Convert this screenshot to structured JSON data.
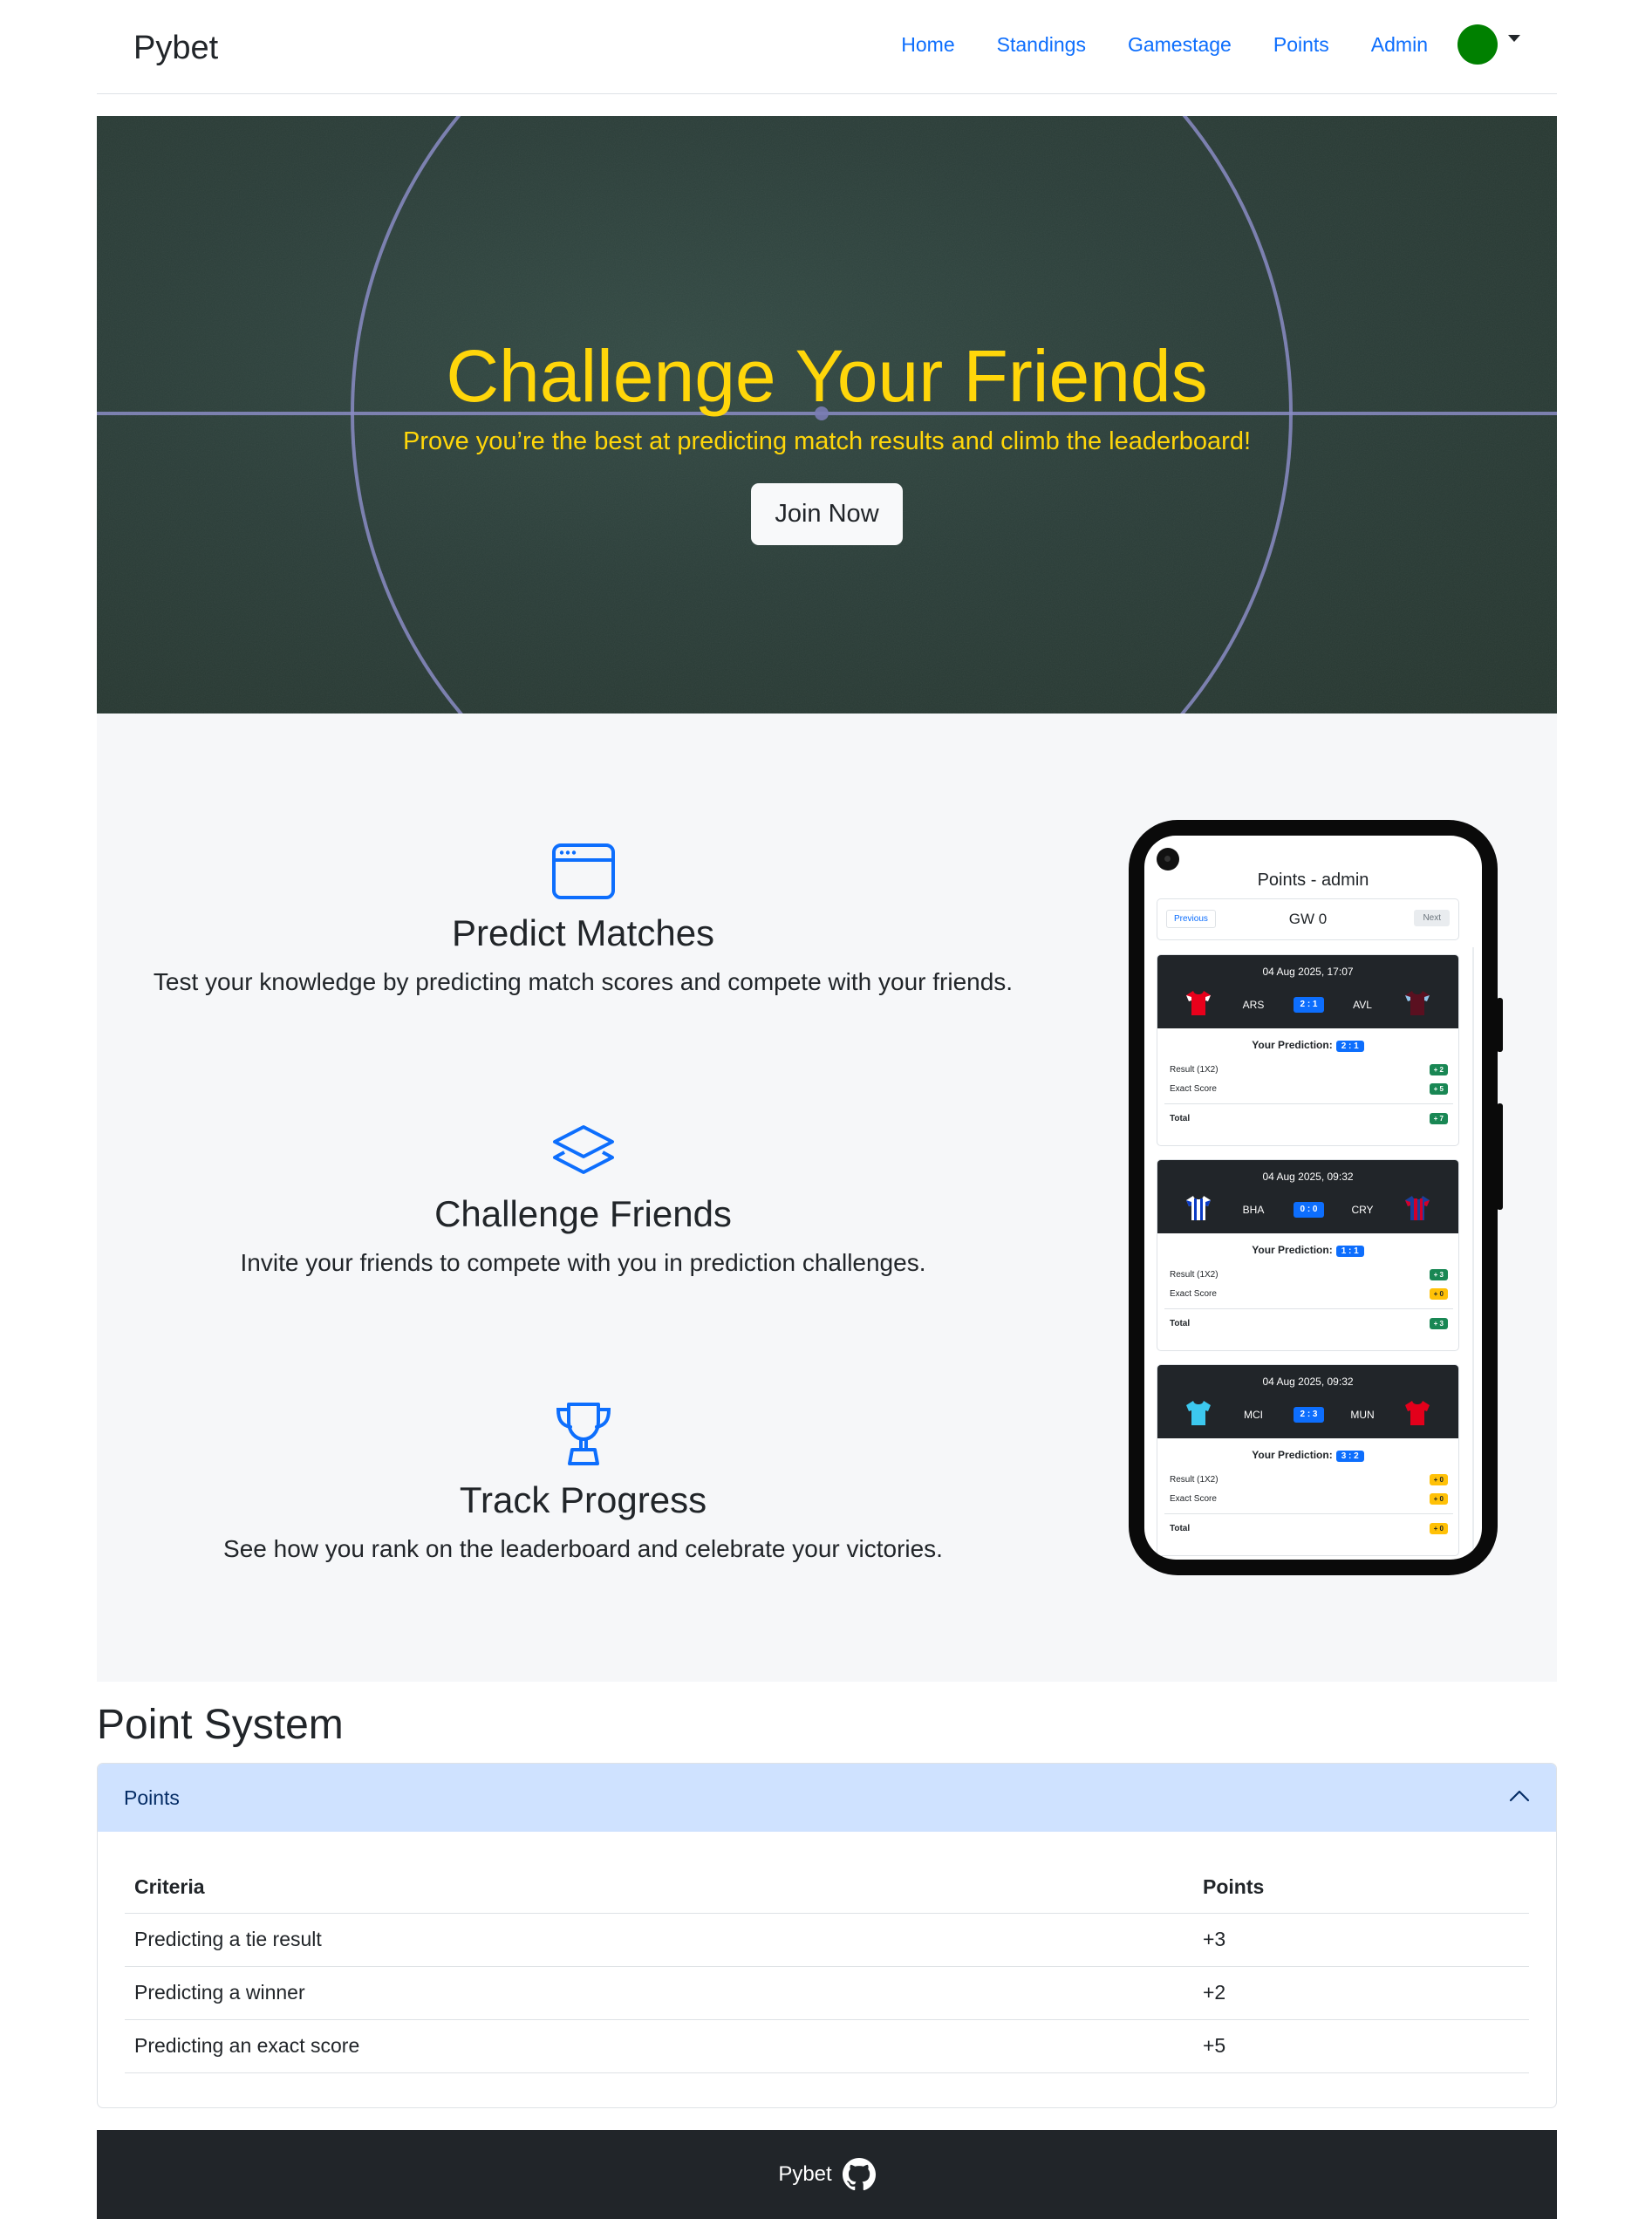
{
  "navbar": {
    "brand": "Pybet",
    "links": [
      "Home",
      "Standings",
      "Gamestage",
      "Points",
      "Admin"
    ],
    "avatar_color": "#008000"
  },
  "hero": {
    "title": "Challenge Your Friends",
    "subtitle": "Prove you’re the best at predicting match results and climb the leaderboard!",
    "button_label": "Join Now",
    "title_color": "#ffd60a"
  },
  "features": [
    {
      "icon": "browser-window-icon",
      "title": "Predict Matches",
      "description": "Test your knowledge by predicting match scores and compete with your friends."
    },
    {
      "icon": "layers-icon",
      "title": "Challenge Friends",
      "description": "Invite your friends to compete with you in prediction challenges."
    },
    {
      "icon": "trophy-icon",
      "title": "Track Progress",
      "description": "See how you rank on the leaderboard and celebrate your victories."
    }
  ],
  "phone": {
    "screen_title": "Points - admin",
    "prev_label": "Previous",
    "next_label": "Next",
    "gameweek": "GW 0",
    "your_prediction_label": "Your Prediction:",
    "result_label": "Result (1X2)",
    "exact_label": "Exact Score",
    "total_label": "Total",
    "matches": [
      {
        "date": "04 Aug 2025, 17:07",
        "home": "ARS",
        "away": "AVL",
        "score": "2 : 1",
        "prediction": "2 : 1",
        "result_pts": "+ 2",
        "exact_pts": "+ 5",
        "total_pts": "+ 7",
        "result_color": "green",
        "exact_color": "green",
        "total_color": "green"
      },
      {
        "date": "04 Aug 2025, 09:32",
        "home": "BHA",
        "away": "CRY",
        "score": "0 : 0",
        "prediction": "1 : 1",
        "result_pts": "+ 3",
        "exact_pts": "+ 0",
        "total_pts": "+ 3",
        "result_color": "green",
        "exact_color": "yellow",
        "total_color": "green"
      },
      {
        "date": "04 Aug 2025, 09:32",
        "home": "MCI",
        "away": "MUN",
        "score": "2 : 3",
        "prediction": "3 : 2",
        "result_pts": "+ 0",
        "exact_pts": "+ 0",
        "total_pts": "+ 0",
        "result_color": "yellow",
        "exact_color": "yellow",
        "total_color": "yellow"
      }
    ]
  },
  "point_system": {
    "title": "Point System",
    "accordion_label": "Points",
    "headers": [
      "Criteria",
      "Points"
    ],
    "rows": [
      [
        "Predicting a tie result",
        "+3"
      ],
      [
        "Predicting a winner",
        "+2"
      ],
      [
        "Predicting an exact score",
        "+5"
      ]
    ]
  },
  "footer": {
    "text": "Pybet",
    "icon": "github-icon"
  }
}
